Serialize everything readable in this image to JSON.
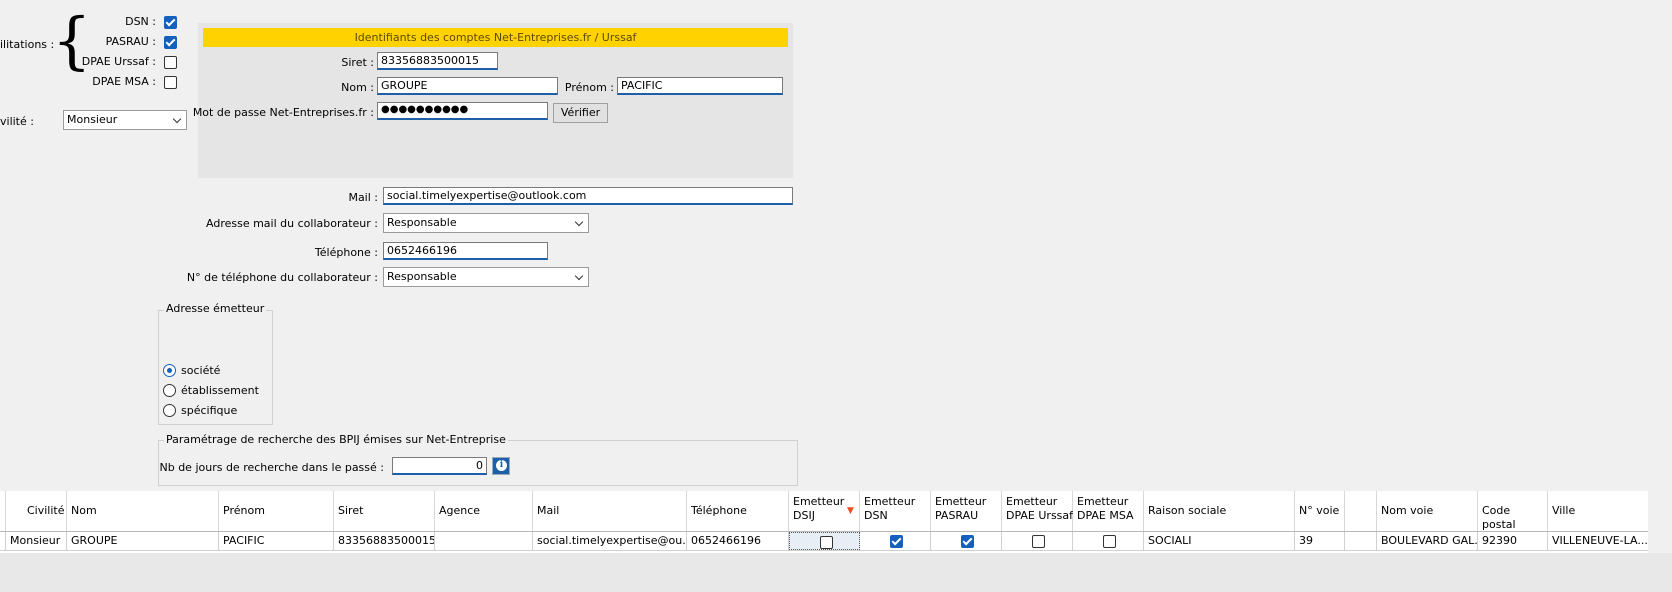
{
  "habilitations": {
    "label": "ilitations :",
    "items": [
      {
        "label": "DSN :",
        "checked": true
      },
      {
        "label": "PASRAU :",
        "checked": true
      },
      {
        "label": "DPAE Urssaf :",
        "checked": false
      },
      {
        "label": "DPAE MSA :",
        "checked": false
      }
    ]
  },
  "civilite": {
    "label": "vilité :",
    "value": "Monsieur"
  },
  "netentreprises": {
    "banner": "Identifiants des comptes Net-Entreprises.fr / Urssaf",
    "siret_label": "Siret :",
    "siret_value": "83356883500015",
    "nom_label": "Nom :",
    "nom_value": "GROUPE",
    "prenom_label": "Prénom :",
    "prenom_value": "PACIFIC",
    "password_label": "Mot de passe Net-Entreprises.fr :",
    "password_value": "●●●●●●●●●●",
    "verify_button": "Vérifier"
  },
  "contact": {
    "mail_label": "Mail :",
    "mail_value": "social.timelyexpertise@outlook.com",
    "collab_mail_label": "Adresse mail du collaborateur :",
    "collab_mail_value": "Responsable",
    "phone_label": "Téléphone :",
    "phone_value": "0652466196",
    "collab_phone_label": "N° de téléphone du collaborateur :",
    "collab_phone_value": "Responsable"
  },
  "adresse_emetteur": {
    "title": "Adresse émetteur",
    "options": [
      {
        "label": "société",
        "selected": true
      },
      {
        "label": "établissement",
        "selected": false
      },
      {
        "label": "spécifique",
        "selected": false
      }
    ]
  },
  "bpij": {
    "title": "Paramétrage de recherche des BPIJ émises sur Net-Entreprise",
    "days_label": "Nb de jours de recherche dans le passé :",
    "days_value": "0",
    "info_icon": "info-icon"
  },
  "table": {
    "headers": [
      "Civilité",
      "Nom",
      "Prénom",
      "Siret",
      "Agence",
      "Mail",
      "Téléphone",
      "Emetteur DSIJ",
      "Emetteur DSN",
      "Emetteur PASRAU",
      "Emetteur DPAE Urssaf",
      "Emetteur DPAE MSA",
      "Raison sociale",
      "N° voie",
      "",
      "Nom voie",
      "Code postal",
      "Ville"
    ],
    "sort_indicator": "▼",
    "row": {
      "civilite": "Monsieur",
      "nom": "GROUPE",
      "prenom": "PACIFIC",
      "siret": "83356883500015",
      "agence": "",
      "mail": "social.timelyexpertise@ou...",
      "telephone": "0652466196",
      "dsij": false,
      "dsn": true,
      "pasrau": true,
      "dpae_urssaf": false,
      "dpae_msa": false,
      "raison_sociale": "SOCIALI",
      "num_voie": "39",
      "extra": "",
      "nom_voie": "BOULEVARD GAL...",
      "code_postal": "92390",
      "ville": "VILLENEUVE-LA..."
    }
  },
  "colors": {
    "accent": "#1560bd",
    "banner": "#ffd200",
    "sort": "#e8501e"
  }
}
